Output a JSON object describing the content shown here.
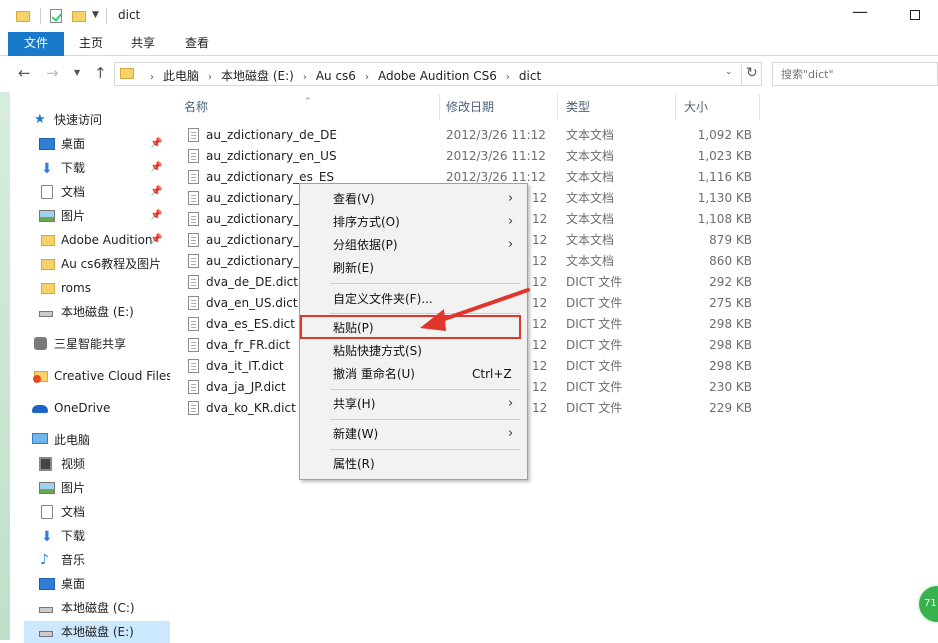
{
  "window": {
    "title": "dict"
  },
  "ribbon": {
    "tabs": [
      "文件",
      "主页",
      "共享",
      "查看"
    ]
  },
  "address": {
    "crumbs": [
      "此电脑",
      "本地磁盘 (E:)",
      "Au cs6",
      "Adobe Audition CS6",
      "dict"
    ],
    "search_placeholder": "搜索\"dict\""
  },
  "nav": {
    "items": [
      {
        "label": "快速访问",
        "icon": "star-icon"
      },
      {
        "label": "桌面",
        "icon": "desktop-icon",
        "pinned": true
      },
      {
        "label": "下载",
        "icon": "download-icon",
        "pinned": true
      },
      {
        "label": "文档",
        "icon": "document-icon",
        "pinned": true
      },
      {
        "label": "图片",
        "icon": "pictures-icon",
        "pinned": true
      },
      {
        "label": "Adobe Audition",
        "icon": "folder-icon",
        "pinned": true
      },
      {
        "label": "Au cs6教程及图片",
        "icon": "folder-icon"
      },
      {
        "label": "roms",
        "icon": "folder-icon"
      },
      {
        "label": "本地磁盘 (E:)",
        "icon": "drive-icon"
      },
      {
        "label": "三星智能共享",
        "icon": "samsung-icon"
      },
      {
        "label": "Creative Cloud Files",
        "icon": "creative-cloud-icon"
      },
      {
        "label": "OneDrive",
        "icon": "onedrive-icon"
      },
      {
        "label": "此电脑",
        "icon": "pc-icon"
      },
      {
        "label": "视频",
        "icon": "video-icon"
      },
      {
        "label": "图片",
        "icon": "pictures-icon"
      },
      {
        "label": "文档",
        "icon": "document-icon"
      },
      {
        "label": "下载",
        "icon": "download-icon"
      },
      {
        "label": "音乐",
        "icon": "music-icon"
      },
      {
        "label": "桌面",
        "icon": "desktop-icon"
      },
      {
        "label": "本地磁盘 (C:)",
        "icon": "drive-icon"
      },
      {
        "label": "本地磁盘 (E:)",
        "icon": "drive-icon",
        "selected": true
      }
    ]
  },
  "columns": {
    "name": "名称",
    "date": "修改日期",
    "type": "类型",
    "size": "大小"
  },
  "files": [
    {
      "name": "au_zdictionary_de_DE",
      "date": "2012/3/26 11:12",
      "type": "文本文档",
      "size": "1,092 KB"
    },
    {
      "name": "au_zdictionary_en_US",
      "date": "2012/3/26 11:12",
      "type": "文本文档",
      "size": "1,023 KB"
    },
    {
      "name": "au_zdictionary_es_ES",
      "date": "2012/3/26 11:12",
      "type": "文本文档",
      "size": "1,116 KB"
    },
    {
      "name": "au_zdictionary_f",
      "date": "12",
      "type": "文本文档",
      "size": "1,130 KB"
    },
    {
      "name": "au_zdictionary_it",
      "date": "12",
      "type": "文本文档",
      "size": "1,108 KB"
    },
    {
      "name": "au_zdictionary_ja",
      "date": "12",
      "type": "文本文档",
      "size": "879 KB"
    },
    {
      "name": "au_zdictionary_k",
      "date": "12",
      "type": "文本文档",
      "size": "860 KB"
    },
    {
      "name": "dva_de_DE.dict",
      "date": "12",
      "type": "DICT 文件",
      "size": "292 KB"
    },
    {
      "name": "dva_en_US.dict",
      "date": "12",
      "type": "DICT 文件",
      "size": "275 KB"
    },
    {
      "name": "dva_es_ES.dict",
      "date": "12",
      "type": "DICT 文件",
      "size": "298 KB"
    },
    {
      "name": "dva_fr_FR.dict",
      "date": "12",
      "type": "DICT 文件",
      "size": "298 KB"
    },
    {
      "name": "dva_it_IT.dict",
      "date": "12",
      "type": "DICT 文件",
      "size": "298 KB"
    },
    {
      "name": "dva_ja_JP.dict",
      "date": "12",
      "type": "DICT 文件",
      "size": "230 KB"
    },
    {
      "name": "dva_ko_KR.dict",
      "date": "12",
      "type": "DICT 文件",
      "size": "229 KB"
    }
  ],
  "context_menu": {
    "items": [
      {
        "label": "查看(V)",
        "submenu": true
      },
      {
        "label": "排序方式(O)",
        "submenu": true
      },
      {
        "label": "分组依据(P)",
        "submenu": true
      },
      {
        "label": "刷新(E)"
      },
      {
        "label": "自定义文件夹(F)..."
      },
      {
        "label": "粘贴(P)",
        "highlighted": true
      },
      {
        "label": "粘贴快捷方式(S)"
      },
      {
        "label": "撤消 重命名(U)",
        "shortcut": "Ctrl+Z"
      },
      {
        "label": "共享(H)",
        "submenu": true
      },
      {
        "label": "新建(W)",
        "submenu": true
      },
      {
        "label": "属性(R)"
      }
    ]
  },
  "badge": {
    "text": "71"
  },
  "colors": {
    "accent": "#1979ca",
    "highlight_red": "#e0362c",
    "selection": "#cce8ff"
  }
}
